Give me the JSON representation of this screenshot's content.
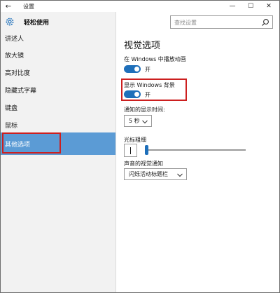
{
  "window": {
    "title": "设置",
    "back_glyph": "←",
    "minimize_glyph": "—",
    "maximize_glyph": "☐",
    "close_glyph": "✕"
  },
  "sidebar": {
    "title": "轻松使用",
    "items": [
      {
        "label": "讲述人",
        "active": false
      },
      {
        "label": "放大镜",
        "active": false
      },
      {
        "label": "高对比度",
        "active": false
      },
      {
        "label": "隐藏式字幕",
        "active": false
      },
      {
        "label": "键盘",
        "active": false
      },
      {
        "label": "鼠标",
        "active": false
      },
      {
        "label": "其他选项",
        "active": true
      }
    ]
  },
  "search": {
    "placeholder": "查找设置"
  },
  "main": {
    "title": "视觉选项",
    "animations": {
      "label": "在 Windows 中播放动画",
      "state": "开"
    },
    "background": {
      "label": "显示 Windows 背景",
      "state": "开"
    },
    "notification_time": {
      "label": "通知的显示时间:",
      "value": "5 秒"
    },
    "cursor_width": {
      "label": "光标粗细"
    },
    "audio_notification": {
      "label": "声音的视觉通知",
      "value": "闪烁活动标题栏"
    }
  },
  "colors": {
    "accent": "#1e6fba",
    "sidebar_active": "#5b9bd5",
    "highlight": "#cc1f1f"
  }
}
